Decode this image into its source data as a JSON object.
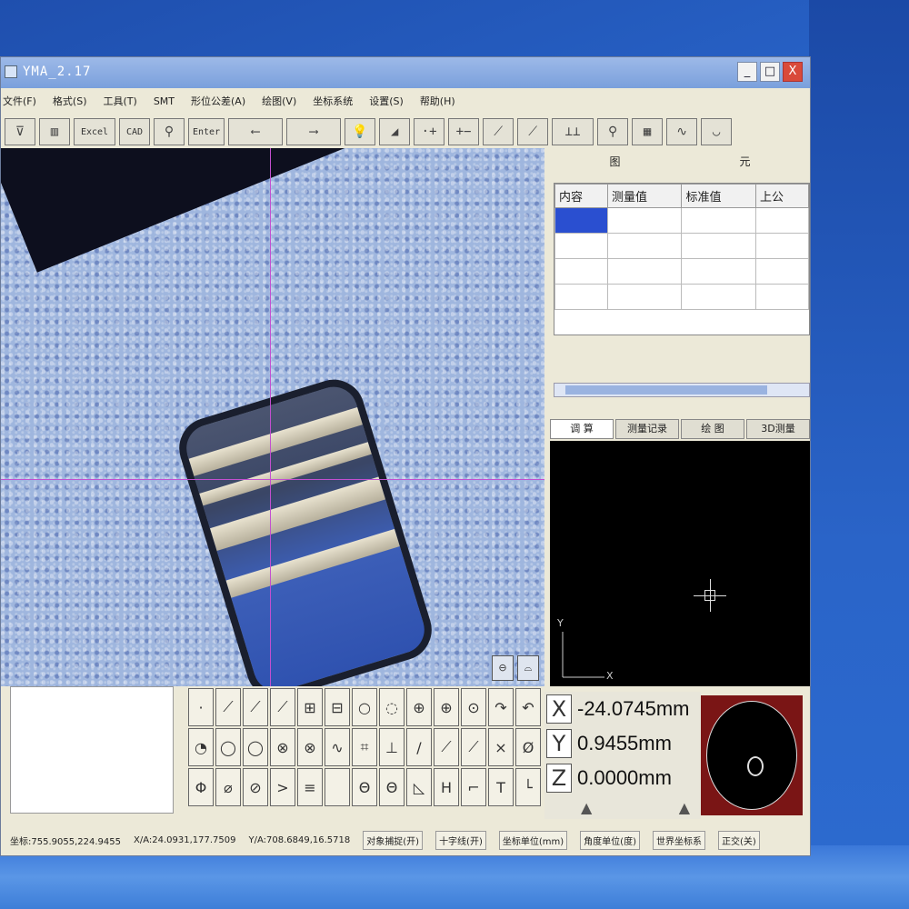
{
  "window": {
    "title": "YMA_2.17",
    "controls": [
      "_",
      "□",
      "X"
    ]
  },
  "menu": [
    "文件(F)",
    "格式(S)",
    "工具(T)",
    "SMT",
    "形位公差(A)",
    "绘图(V)",
    "坐标系统",
    "设置(S)",
    "帮助(H)"
  ],
  "toolbar": {
    "buttons": [
      "Excel",
      "CAD",
      "Enter"
    ]
  },
  "right_panel": {
    "title_left": "图",
    "title_right": "元",
    "table_headers": [
      "内容",
      "测量值",
      "标准值",
      "上公"
    ],
    "tabs": [
      "调 算",
      "测量记录",
      "绘 图",
      "3D测量"
    ],
    "graph_axis_y": "Y",
    "graph_axis_x": "X"
  },
  "coords": {
    "x_label": "X",
    "y_label": "Y",
    "z_label": "Z",
    "x_value": "-24.0745mm",
    "y_value": "0.9455mm",
    "z_value": "0.0000mm"
  },
  "statusbar": {
    "coord": "坐标:755.9055,224.9455",
    "xa": "X/A:24.0931,177.7509",
    "ya": "Y/A:708.6849,16.5718",
    "capture": "对象捕捉(开)",
    "crosshair": "十字线(开)",
    "unit": "坐标单位(mm)",
    "angle_unit": "角度单位(度)",
    "world": "世界坐标系",
    "ortho": "正交(关)"
  }
}
